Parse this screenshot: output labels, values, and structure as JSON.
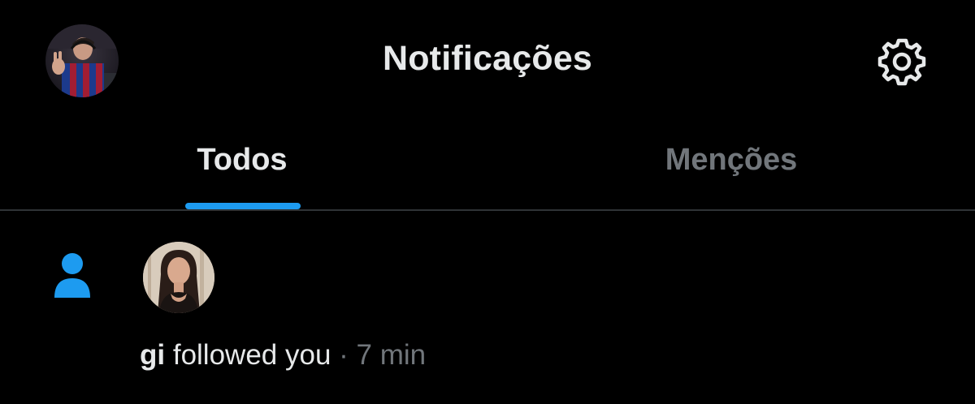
{
  "header": {
    "title": "Notificações",
    "avatar_icon": "profile-avatar",
    "settings_icon": "gear-icon"
  },
  "tabs": [
    {
      "label": "Todos",
      "active": true
    },
    {
      "label": "Menções",
      "active": false
    }
  ],
  "notifications": [
    {
      "type_icon": "person-icon",
      "user": "gi",
      "action": "followed you",
      "separator": "·",
      "time": "7 min"
    }
  ],
  "colors": {
    "background": "#000000",
    "text_primary": "#e7e9ea",
    "text_secondary": "#71767b",
    "accent": "#1d9bf0",
    "divider": "#2f3336"
  }
}
